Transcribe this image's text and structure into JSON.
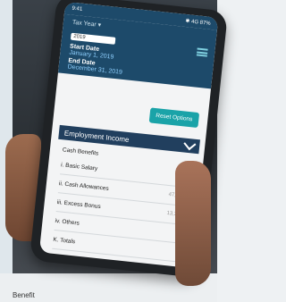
{
  "phone": {
    "status_time": "9:41",
    "status_right": "✱ 4G 87%"
  },
  "header": {
    "tax_year_label": "Tax Year ▾",
    "year_value": "2019",
    "start_label": "Start Date",
    "start_value": "January 1, 2019",
    "end_label": "End Date",
    "end_value": "December 31, 2019"
  },
  "actions": {
    "reset_label": "Reset Options"
  },
  "section": {
    "title": "Employment Income"
  },
  "rows": [
    {
      "label": "Cash Benefits",
      "value": ""
    },
    {
      "label": "i. Basic Salary",
      "value": ""
    },
    {
      "label": "ii. Cash Allowances",
      "value": "47,694.35"
    },
    {
      "label": "iii. Excess Bonus",
      "value": "13,314.80"
    },
    {
      "label": "iv. Others",
      "value": ""
    },
    {
      "label": "K. Totals",
      "value": ""
    }
  ],
  "footer": {
    "text": "Benefit"
  }
}
